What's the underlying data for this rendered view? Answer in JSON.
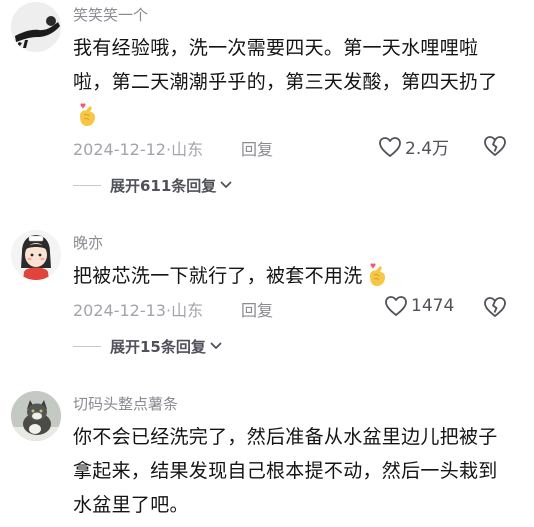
{
  "comments": [
    {
      "username": "笑笑笑一个",
      "text": "我有经验哦，洗一次需要四天。第一天水哩哩啦啦，第二天潮潮乎乎的，第三天发酸，第四天扔了",
      "date": "2024-12-12",
      "location": "山东",
      "reply_label": "回复",
      "likes": "2.4万",
      "expand_label": "展开611条回复"
    },
    {
      "username": "晚亦",
      "text": "把被芯洗一下就行了，被套不用洗",
      "date": "2024-12-13",
      "location": "山东",
      "reply_label": "回复",
      "likes": "1474",
      "expand_label": "展开15条回复"
    },
    {
      "username": "切码头整点薯条",
      "text": "你不会已经洗完了，然后准备从水盆里边儿把被子拿起来，结果发现自己根本提不动，然后一头栽到水盆里了吧。"
    }
  ],
  "separator": "·",
  "icons": {
    "like": "heart-outline-icon",
    "dislike": "broken-heart-icon",
    "expand": "chevron-down-icon",
    "emoji": "finger-heart-emoji"
  },
  "colors": {
    "text": "#141414",
    "muted": "#a3a4ab",
    "username": "#8a8b93",
    "emoji": "#f6c644"
  }
}
